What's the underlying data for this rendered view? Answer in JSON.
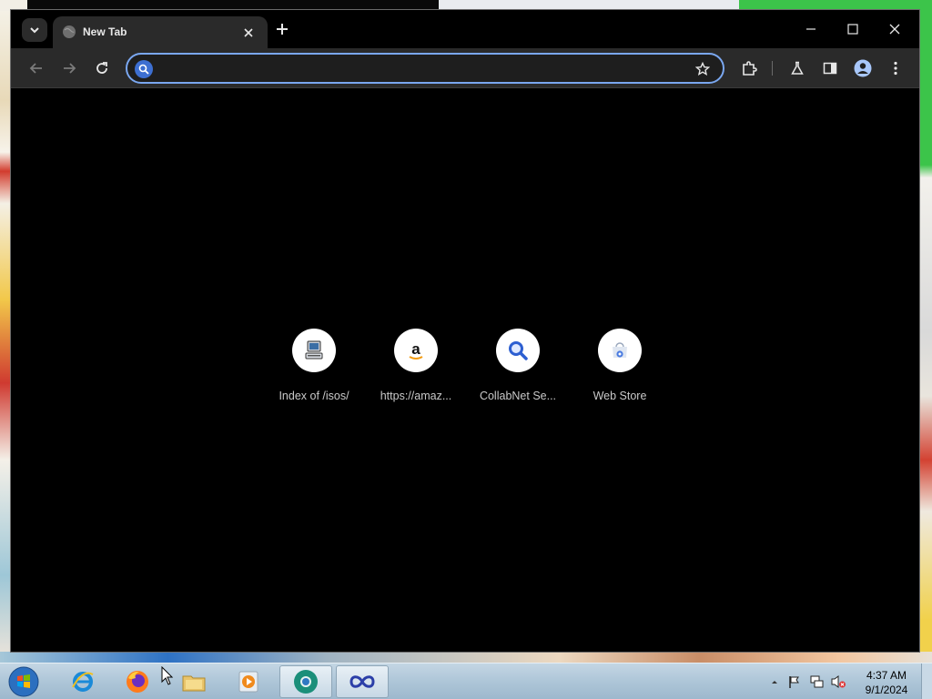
{
  "browser": {
    "tab": {
      "title": "New Tab"
    },
    "omnibox": {
      "value": "",
      "placeholder": ""
    },
    "shortcuts": [
      {
        "label": "Index of /isos/",
        "icon": "computer-icon"
      },
      {
        "label": "https://amaz...",
        "icon": "amazon-icon"
      },
      {
        "label": "CollabNet Se...",
        "icon": "magnifier-icon"
      },
      {
        "label": "Web Store",
        "icon": "web-store-icon"
      }
    ]
  },
  "taskbar": {
    "apps": [
      "internet-explorer-icon",
      "firefox-icon",
      "file-explorer-icon",
      "media-player-icon",
      "chrome-dev-icon",
      "infinity-app-icon"
    ],
    "clock": {
      "time": "4:37 AM",
      "date": "9/1/2024"
    }
  },
  "colors": {
    "accent": "#7aa7f0",
    "toolbar": "#2a2a2a",
    "page": "#000000"
  }
}
